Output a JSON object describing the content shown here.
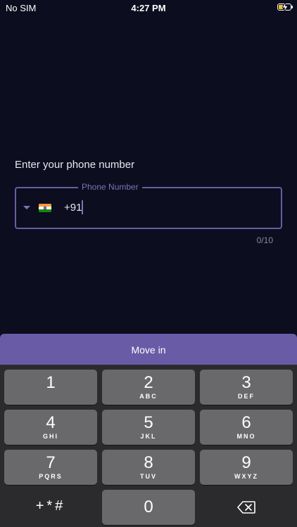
{
  "status_bar": {
    "carrier": "No SIM",
    "time": "4:27 PM",
    "battery_icon": "battery-charging-icon"
  },
  "form": {
    "heading": "Enter your phone number",
    "field_label": "Phone Number",
    "country_flag_icon": "india-flag-icon",
    "dial_code": "+91",
    "phone_value": "",
    "char_counter": "0/10"
  },
  "move_in_button": {
    "label": "Move in"
  },
  "keypad": {
    "keys": [
      {
        "digit": "1",
        "letters": ""
      },
      {
        "digit": "2",
        "letters": "ABC"
      },
      {
        "digit": "3",
        "letters": "DEF"
      },
      {
        "digit": "4",
        "letters": "GHI"
      },
      {
        "digit": "5",
        "letters": "JKL"
      },
      {
        "digit": "6",
        "letters": "MNO"
      },
      {
        "digit": "7",
        "letters": "PQRS"
      },
      {
        "digit": "8",
        "letters": "TUV"
      },
      {
        "digit": "9",
        "letters": "WXYZ"
      },
      {
        "digit": "0",
        "letters": ""
      }
    ],
    "symbols_label": "+*#",
    "delete_icon": "backspace-icon"
  },
  "colors": {
    "background": "#0c0d1e",
    "accent": "#6a5ba6",
    "keypad_bg": "#2b2b2e",
    "key_bg": "#69696b"
  }
}
